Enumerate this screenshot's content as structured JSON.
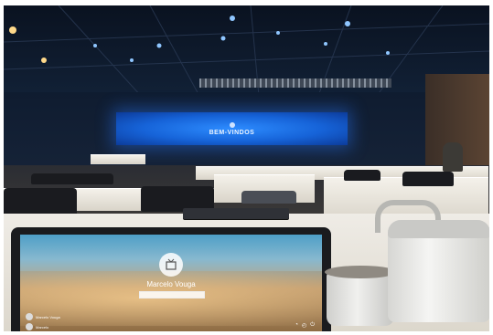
{
  "scene": {
    "venue_screen_text": "BEM-VINDOS",
    "laptop": {
      "user_name": "Marcelo Vouga",
      "accounts": [
        "Marcelo Vouga",
        "Marcelo"
      ]
    }
  },
  "colors": {
    "screen_blue": "#1663d8",
    "ceiling": "#0b1424",
    "tablecloth": "#efece6"
  }
}
